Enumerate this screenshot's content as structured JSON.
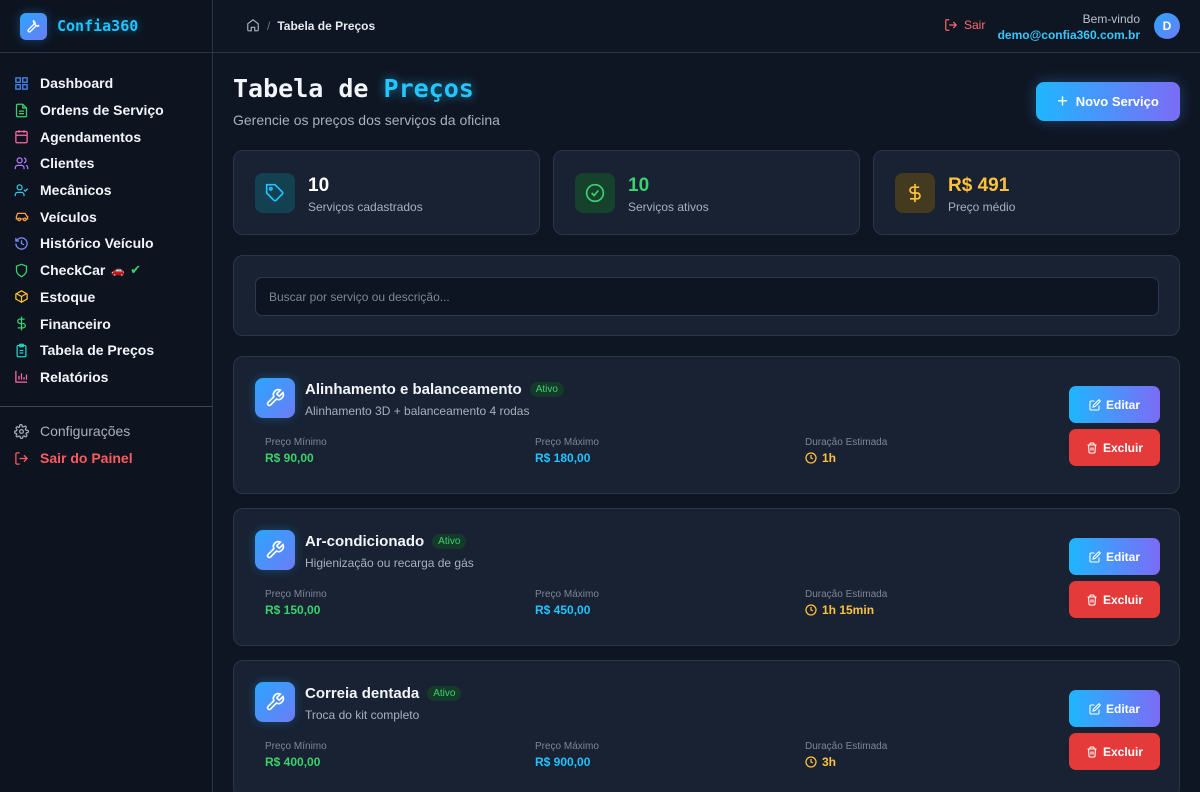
{
  "app": {
    "name": "Confia360"
  },
  "sidebar": {
    "items": [
      {
        "label": "Dashboard",
        "icon": "grid-icon",
        "color": "#4c8dff"
      },
      {
        "label": "Ordens de Serviço",
        "icon": "document-icon",
        "color": "#3ad26b"
      },
      {
        "label": "Agendamentos",
        "icon": "calendar-icon",
        "color": "#ff6aa6"
      },
      {
        "label": "Clientes",
        "icon": "users-icon",
        "color": "#b57bff"
      },
      {
        "label": "Mecânicos",
        "icon": "user-check-icon",
        "color": "#2ec8e8"
      },
      {
        "label": "Veículos",
        "icon": "car-icon",
        "color": "#ff9f43"
      },
      {
        "label": "Histórico Veículo",
        "icon": "history-icon",
        "color": "#7c8cff"
      },
      {
        "label": "CheckCar",
        "icon": "shield-icon",
        "color": "#3ad26b"
      },
      {
        "label": "Estoque",
        "icon": "box-icon",
        "color": "#ffc23a"
      },
      {
        "label": "Financeiro",
        "icon": "dollar-icon",
        "color": "#3ad26b"
      },
      {
        "label": "Tabela de Preços",
        "icon": "clipboard-icon",
        "color": "#22d3c5"
      },
      {
        "label": "Relatórios",
        "icon": "bar-chart-icon",
        "color": "#ff6aa6"
      }
    ],
    "config_label": "Configurações",
    "exit_label": "Sair do Painel"
  },
  "topbar": {
    "breadcrumb_sep": "/",
    "breadcrumb_current": "Tabela de Preços",
    "logout_label": "Sair",
    "welcome": "Bem-vindo",
    "email": "demo@confia360.com.br",
    "avatar_initial": "D"
  },
  "page": {
    "title_part1": "Tabela de",
    "title_part2": "Preços",
    "subtitle": "Gerencie os preços dos serviços da oficina",
    "new_button": "Novo Serviço"
  },
  "stats": [
    {
      "value": "10",
      "label": "Serviços cadastrados",
      "color": "#ffffff",
      "icon": "tag-icon"
    },
    {
      "value": "10",
      "label": "Serviços ativos",
      "color": "#3ad26b",
      "icon": "check-circle-icon"
    },
    {
      "value": "R$ 491",
      "label": "Preço médio",
      "color": "#ffc23a",
      "icon": "dollar-icon"
    }
  ],
  "search": {
    "placeholder": "Buscar por serviço ou descrição..."
  },
  "columns": {
    "min": "Preço Mínimo",
    "max": "Preço Máximo",
    "duration": "Duração Estimada"
  },
  "actions": {
    "edit": "Editar",
    "delete": "Excluir"
  },
  "services": [
    {
      "name": "Alinhamento e balanceamento",
      "status": "Ativo",
      "description": "Alinhamento 3D + balanceamento 4 rodas",
      "min": "R$ 90,00",
      "max": "R$ 180,00",
      "duration": "1h"
    },
    {
      "name": "Ar-condicionado",
      "status": "Ativo",
      "description": "Higienização ou recarga de gás",
      "min": "R$ 150,00",
      "max": "R$ 450,00",
      "duration": "1h 15min"
    },
    {
      "name": "Correia dentada",
      "status": "Ativo",
      "description": "Troca do kit completo",
      "min": "R$ 400,00",
      "max": "R$ 900,00",
      "duration": "3h"
    }
  ]
}
